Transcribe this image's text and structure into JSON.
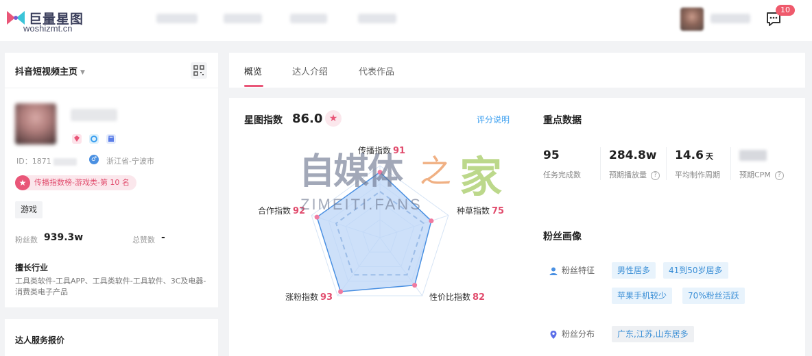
{
  "brand": {
    "logo_text": "巨量星图",
    "watermark_domain": "woshizmt.cn"
  },
  "header": {
    "message_badge": "10"
  },
  "left_panel": {
    "platform_select": "抖音短视频主页",
    "kol": {
      "id_prefix": "ID：1871",
      "region": "浙江省-宁波市",
      "rank": "传播指数榜-游戏类-第 10 名",
      "category_tag": "游戏",
      "fans_label": "粉丝数",
      "fans_value": "939.3w",
      "likes_label": "总赞数",
      "likes_value": "-",
      "industry_title": "擅长行业",
      "industry_text": "工具类软件-工具APP、工具类软件-工具软件、3C及电器-消费类电子产品"
    },
    "service_price_title": "达人服务报价"
  },
  "tabs": [
    {
      "label": "概览",
      "active": true
    },
    {
      "label": "达人介绍",
      "active": false
    },
    {
      "label": "代表作品",
      "active": false
    }
  ],
  "xingtu": {
    "title": "星图指数",
    "score": "86.0",
    "rule_link": "评分说明",
    "radar": [
      {
        "label": "传播指数",
        "value": 91
      },
      {
        "label": "种草指数",
        "value": 75
      },
      {
        "label": "性价比指数",
        "value": 82
      },
      {
        "label": "涨粉指数",
        "value": 93
      },
      {
        "label": "合作指数",
        "value": 92
      }
    ]
  },
  "key_data": {
    "title": "重点数据",
    "items": [
      {
        "value": "95",
        "unit": "",
        "label": "任务完成数",
        "help": false
      },
      {
        "value": "284.8w",
        "unit": "",
        "label": "预期播放量",
        "help": true
      },
      {
        "value": "14.6",
        "unit": "天",
        "label": "平均制作周期",
        "help": false
      },
      {
        "value": "",
        "unit": "",
        "label": "预期CPM",
        "help": true
      }
    ]
  },
  "fans_profile": {
    "title": "粉丝画像",
    "feature_label": "粉丝特征",
    "feature_tags": [
      "男性居多",
      "41到50岁居多",
      "苹果手机较少",
      "70%粉丝活跃"
    ],
    "region_label": "粉丝分布",
    "region_tags": [
      "广东,江苏,山东居多"
    ]
  },
  "watermark": {
    "cn_main": "自媒体",
    "cn_zhi": "之",
    "cn_home": "家",
    "en": "ZIMEITI.FANS"
  },
  "colors": {
    "accent_pink": "#e95678",
    "link_blue": "#3b9ff0",
    "radar_fill": "#bcd6f7",
    "radar_stroke": "#4a90e2"
  }
}
